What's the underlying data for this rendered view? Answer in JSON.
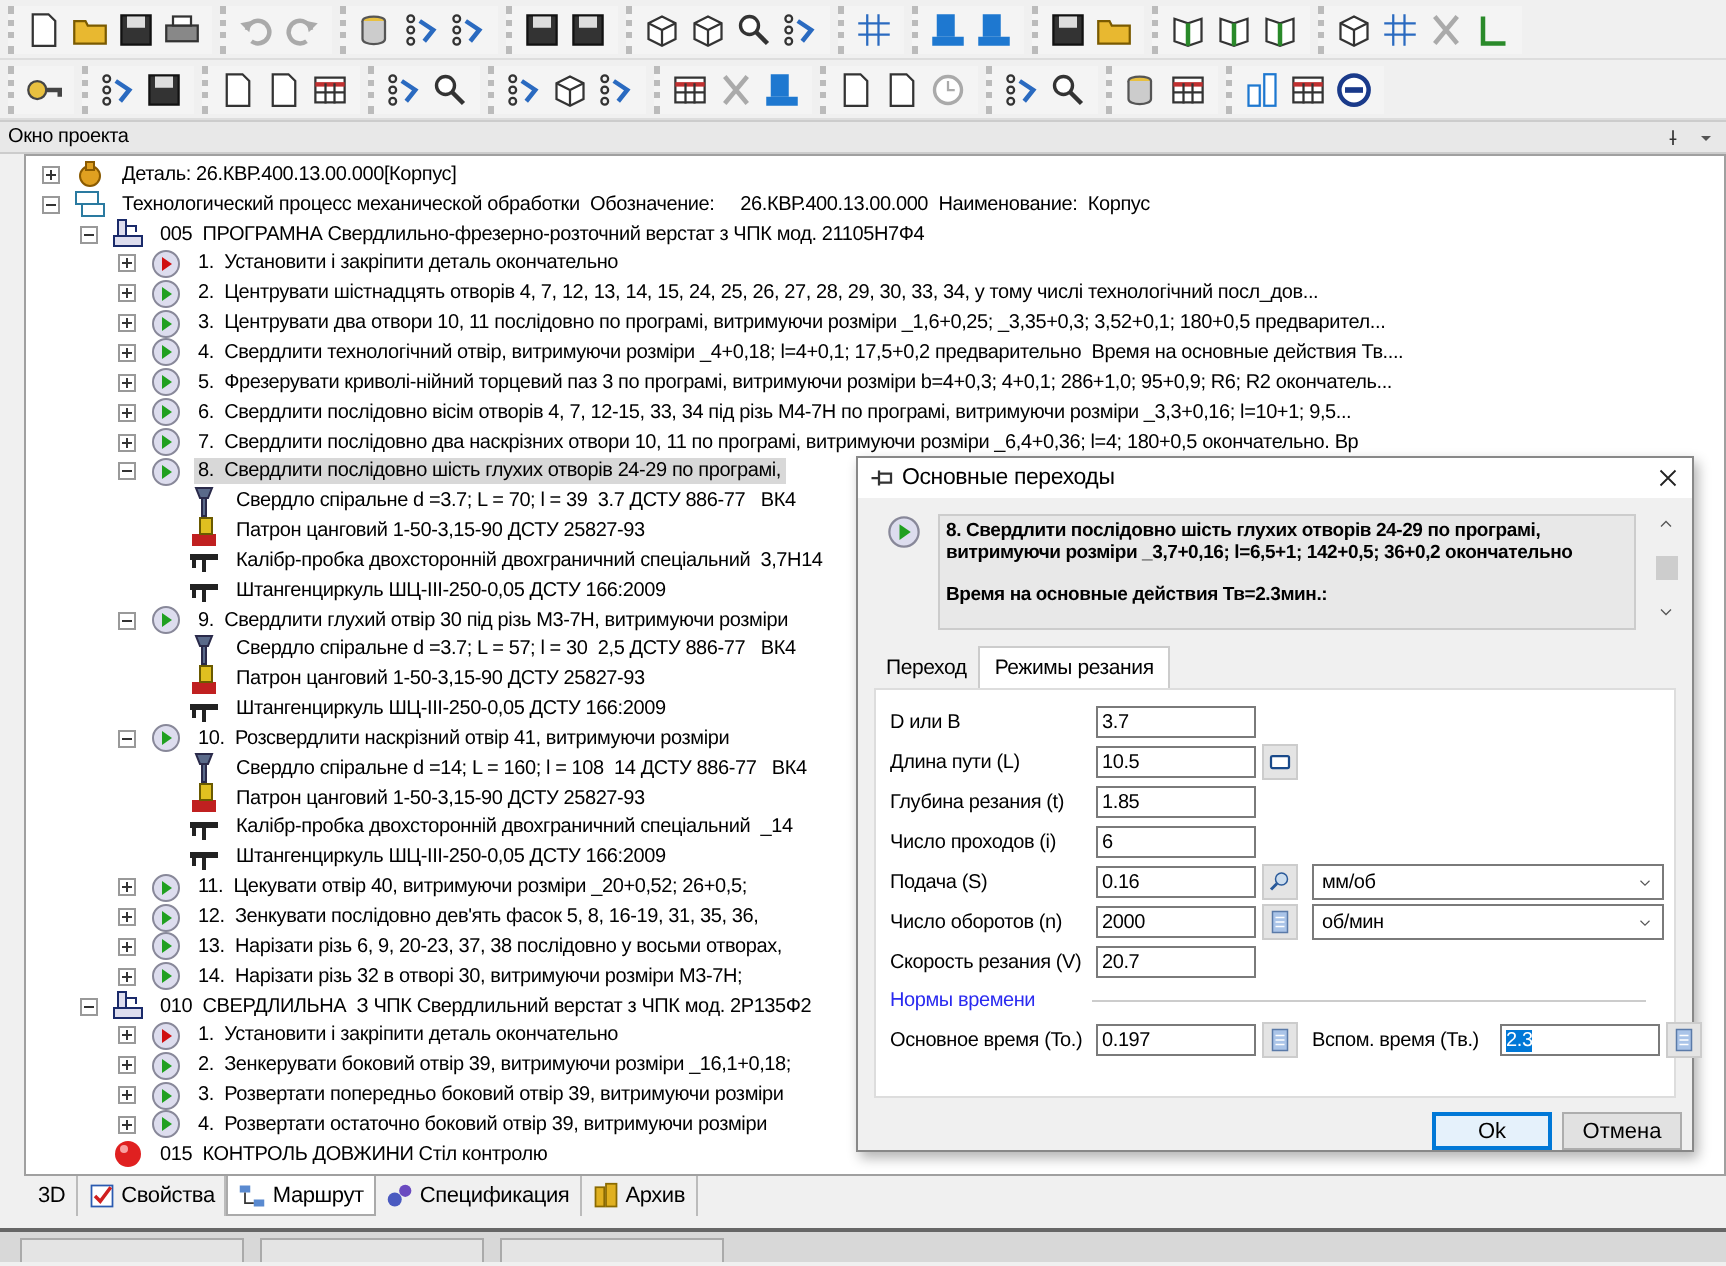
{
  "project_window": {
    "title": "Окно проекта"
  },
  "tree": [
    {
      "kind": "part",
      "text": "Деталь: 26.КВР.400.13.00.000[Корпус]",
      "expanded": false,
      "selected": false
    },
    {
      "kind": "process",
      "text": "Технологический процесс механической обработки  Обозначение:     26.КВР.400.13.00.000  Наименование:  Корпус",
      "expanded": true,
      "selected": false,
      "children": [
        {
          "kind": "operation",
          "text": "005  ПРОГРАМНА Свердлильно-фрезерно-розточний верстат з ЧПК мод. 21105Н7Ф4",
          "expanded": true,
          "selected": false,
          "children": [
            {
              "kind": "setup",
              "text": "1.  Установити і закріпити деталь окончательно",
              "expanded": false,
              "selected": false
            },
            {
              "kind": "step",
              "text": "2.  Центрувати шістнадцять отворів 4, 7, 12, 13, 14, 15, 24, 25, 26, 27, 28, 29, 30, 33, 34, у тому числі технологічний посл_дов...",
              "expanded": false,
              "selected": false
            },
            {
              "kind": "step",
              "text": "3.  Центрувати два отвори 10, 11 послідовно по програмі, витримуючи розміри _1,6+0,25; _3,35+0,3; 3,52+0,1; 180+0,5 предварител...",
              "expanded": false,
              "selected": false
            },
            {
              "kind": "step",
              "text": "4.  Свердлити технологічний отвір, витримуючи розміри _4+0,18; l=4+0,1; 17,5+0,2 предварительно  Время на основные действия Тв....",
              "expanded": false,
              "selected": false
            },
            {
              "kind": "step",
              "text": "5.  Фрезерувати криволі-нійний торцевий паз 3 по програмі, витримуючи розміри b=4+0,3; 4+0,1; 286+1,0; 95+0,9; R6; R2 окончатель...",
              "expanded": false,
              "selected": false
            },
            {
              "kind": "step",
              "text": "6.  Свердлити послідовно вісім отворів 4, 7, 12-15, 33, 34 під різь М4-7Н по програмі, витримуючи розміри _3,3+0,16; l=10+1; 9,5...",
              "expanded": false,
              "selected": false
            },
            {
              "kind": "step",
              "text": "7.  Свердлити послідовно два наскрізних отвори 10, 11 по програмі, витримуючи розміри _6,4+0,36; l=4; 180+0,5 окончательно. Вр",
              "expanded": false,
              "selected": false
            },
            {
              "kind": "step",
              "text": "8.  Свердлити послідовно шість глухих отворів 24-29 по програмі,",
              "expanded": true,
              "selected": true,
              "children": [
                {
                  "kind": "drill",
                  "text": "Свердло спіральне d =3.7; L = 70; l = 39  3.7 ДСТУ 886-77   ВК4",
                  "selected": false
                },
                {
                  "kind": "chuck",
                  "text": "Патрон цанговий 1-50-3,15-90 ДСТУ 25827-93",
                  "selected": false
                },
                {
                  "kind": "gauge",
                  "text": "Калібр-пробка двохсторонній двохграничний спеціальний  3,7Н14",
                  "selected": false
                },
                {
                  "kind": "gauge",
                  "text": "Штангенциркуль ШЦ-ІІІ-250-0,05 ДСТУ 166:2009",
                  "selected": false
                }
              ]
            },
            {
              "kind": "step",
              "text": "9.  Свердлити глухий отвір 30 під різь М3-7Н, витримуючи розміри",
              "expanded": true,
              "selected": false,
              "children": [
                {
                  "kind": "drill",
                  "text": "Свердло спіральне d =3.7; L = 57; l = 30  2,5 ДСТУ 886-77   ВК4",
                  "selected": false
                },
                {
                  "kind": "chuck",
                  "text": "Патрон цанговий 1-50-3,15-90 ДСТУ 25827-93",
                  "selected": false
                },
                {
                  "kind": "gauge",
                  "text": "Штангенциркуль ШЦ-ІІІ-250-0,05 ДСТУ 166:2009",
                  "selected": false
                }
              ]
            },
            {
              "kind": "step",
              "text": "10.  Розсвердлити наскрізний отвір 41, витримуючи розміри",
              "expanded": true,
              "selected": false,
              "children": [
                {
                  "kind": "drill",
                  "text": "Свердло спіральне d =14; L = 160; l = 108  14 ДСТУ 886-77   ВК4",
                  "selected": false
                },
                {
                  "kind": "chuck",
                  "text": "Патрон цанговий 1-50-3,15-90 ДСТУ 25827-93",
                  "selected": false
                },
                {
                  "kind": "gauge",
                  "text": "Калібр-пробка двохсторонній двохграничний спеціальний  _14",
                  "selected": false
                },
                {
                  "kind": "gauge",
                  "text": "Штангенциркуль ШЦ-ІІІ-250-0,05 ДСТУ 166:2009",
                  "selected": false
                }
              ]
            },
            {
              "kind": "step",
              "text": "11.  Цекувати отвір 40, витримуючи розміри _20+0,52; 26+0,5;",
              "expanded": false,
              "selected": false
            },
            {
              "kind": "step",
              "text": "12.  Зенкувати послідовно дев'ять фасок 5, 8, 16-19, 31, 35, 36,",
              "expanded": false,
              "selected": false
            },
            {
              "kind": "step",
              "text": "13.  Нарізати різь 6, 9, 20-23, 37, 38 послідовно у восьми отворах,",
              "expanded": false,
              "selected": false
            },
            {
              "kind": "step",
              "text": "14.  Нарізати різь 32 в отворі 30, витримуючи розміри М3-7Н;",
              "expanded": false,
              "selected": false
            }
          ]
        },
        {
          "kind": "operation",
          "text": "010  СВЕРДЛИЛЬНА  З ЧПК Свердлильний верстат з ЧПК мод. 2Р135Ф2",
          "expanded": true,
          "selected": false,
          "children": [
            {
              "kind": "setup",
              "text": "1.  Установити і закріпити деталь окончательно",
              "expanded": false,
              "selected": false
            },
            {
              "kind": "step",
              "text": "2.  Зенкерувати боковий отвір 39, витримуючи розміри _16,1+0,18;",
              "expanded": false,
              "selected": false
            },
            {
              "kind": "step",
              "text": "3.  Розвертати попередньо боковий отвір 39, витримуючи розміри",
              "expanded": false,
              "selected": false
            },
            {
              "kind": "step",
              "text": "4.  Розвертати остаточно боковий отвір 39, витримуючи розміри",
              "expanded": false,
              "selected": false
            }
          ]
        },
        {
          "kind": "control",
          "text": "015  КОНТРОЛЬ ДОВЖИНИ Стіл контролю",
          "selected": false
        }
      ]
    }
  ],
  "bottom_tabs": [
    {
      "label": "3D",
      "selected": false
    },
    {
      "label": "Свойства",
      "selected": false
    },
    {
      "label": "Маршрут",
      "selected": true
    },
    {
      "label": "Спецификация",
      "selected": false
    },
    {
      "label": "Архив",
      "selected": false
    }
  ],
  "dialog": {
    "title": "Основные переходы",
    "description": [
      "8.  Свердлити послідовно шість глухих отворів 24-29 по програмі, витримуючи розміри _3,7+0,16; l=6,5+1; 142+0,5; 36+0,2 окончательно",
      "Время на основные действия Тв=2.3мин.:"
    ],
    "tabs": [
      {
        "label": "Переход",
        "selected": false
      },
      {
        "label": "Режимы резания",
        "selected": true
      }
    ],
    "fields": [
      {
        "label": "D или B",
        "value": "3.7"
      },
      {
        "label": "Длина пути (L)",
        "value": "10.5",
        "kind": "table"
      },
      {
        "label": "Глубина резания (t)",
        "value": "1.85"
      },
      {
        "label": "Число проходов (i)",
        "value": "6"
      },
      {
        "label": "Подача (S)",
        "value": "0.16",
        "kind": "search",
        "unit": "мм/об"
      },
      {
        "label": "Число оборотов (n)",
        "value": "2000",
        "kind": "calc",
        "unit": "об/мин"
      },
      {
        "label": "Скорость резания (V)",
        "value": "20.7"
      }
    ],
    "time_norms": {
      "title": "Нормы времени",
      "fields": [
        {
          "label": "Основное время (To.)",
          "value": "0.197",
          "kind": "calc",
          "text_selected": false
        },
        {
          "label": "Вспом. время (Тв.)",
          "value": "2.3",
          "kind": "calc",
          "text_selected": true
        }
      ]
    },
    "buttons": [
      {
        "label": "Ok",
        "default": true
      },
      {
        "label": "Отмена",
        "default": false
      }
    ]
  }
}
